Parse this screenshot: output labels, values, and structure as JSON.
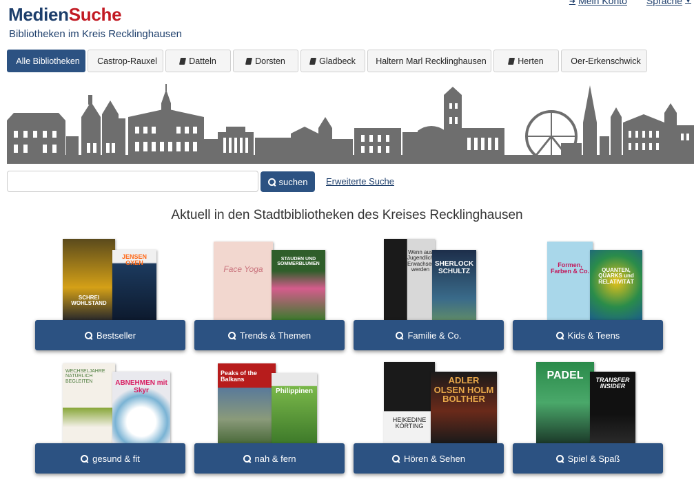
{
  "header": {
    "logo_part1": "Medien",
    "logo_part2": "Suche",
    "tagline": "Bibliotheken im Kreis Recklinghausen",
    "account_link": "Mein Konto",
    "language_link": "Sprache"
  },
  "tabs": [
    {
      "label": "Alle Bibliotheken",
      "active": true
    },
    {
      "label": "Castrop-Rauxel",
      "active": false
    },
    {
      "label": "Datteln",
      "active": false
    },
    {
      "label": "Dorsten",
      "active": false
    },
    {
      "label": "Gladbeck",
      "active": false
    },
    {
      "label": "Haltern Marl Recklinghausen",
      "active": false
    },
    {
      "label": "Herten",
      "active": false
    },
    {
      "label": "Oer-Erkenschwick",
      "active": false
    }
  ],
  "search": {
    "value": "",
    "button_label": "suchen",
    "advanced_label": "Erweiterte Suche"
  },
  "headline": "Aktuell in den Stadtbibliotheken des Kreises Recklinghausen",
  "categories": [
    {
      "label": "Bestseller",
      "book1": "SCHREI WOHLSTAND",
      "book2": "JENSEN OXEN"
    },
    {
      "label": "Trends & Themen",
      "book1": "Face Yoga",
      "book2": "STAUDEN UND SOMMERBLUMEN"
    },
    {
      "label": "Familie & Co.",
      "book1": "Wenn aus Jugendlichen Erwachsene werden",
      "book2": "SHERLOCK SCHULTZ"
    },
    {
      "label": "Kids & Teens",
      "book1": "Formen, Farben & Co.",
      "book2": "QUANTEN, QUARKS und RELATIVITÄT"
    },
    {
      "label": "gesund & fit",
      "book1": "WECHSELJAHRE NATÜRLICH BEGLEITEN",
      "book2": "ABNEHMEN mit Skyr"
    },
    {
      "label": "nah & fern",
      "book1": "Peaks of the Balkans",
      "book2": "Philippinen"
    },
    {
      "label": "Hören & Sehen",
      "book1": "HEIKEDINE KÖRTING",
      "book2": "ADLER OLSEN HOLM BOLTHER"
    },
    {
      "label": "Spiel & Spaß",
      "book1": "PADEL",
      "book2": "TRANSFER INSIDER"
    }
  ],
  "colors": {
    "primary": "#2c5282",
    "logo_blue": "#1d3e6b",
    "logo_red": "#c21a23",
    "skyline": "#6e6e6e"
  }
}
